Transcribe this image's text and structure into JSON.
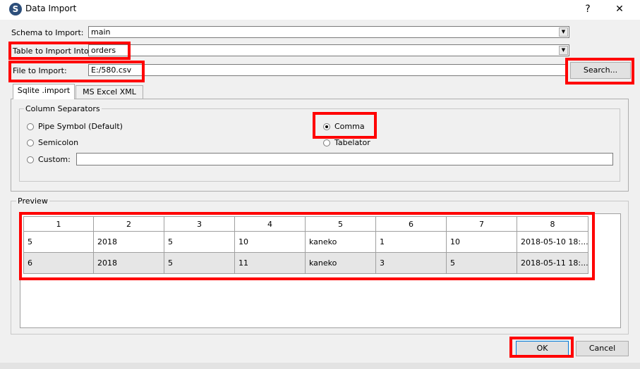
{
  "window": {
    "title": "Data Import",
    "help_glyph": "?",
    "close_glyph": "✕",
    "icon_letter": "S"
  },
  "form": {
    "schema_label": "Schema to Import:",
    "schema_value": "main",
    "table_label": "Table to Import Into:",
    "table_value": "orders",
    "file_label": "File to Import:",
    "file_value": "E:/580.csv",
    "search_label": "Search..."
  },
  "tabs": [
    {
      "label": "Sqlite .import"
    },
    {
      "label": "MS Excel XML"
    }
  ],
  "separators": {
    "group_label": "Column Separators",
    "pipe": "Pipe Symbol (Default)",
    "semicolon": "Semicolon",
    "custom": "Custom:",
    "comma": "Comma",
    "tabulator": "Tabelator",
    "selected": "comma"
  },
  "preview": {
    "group_label": "Preview",
    "columns": [
      "1",
      "2",
      "3",
      "4",
      "5",
      "6",
      "7",
      "8"
    ],
    "rows": [
      [
        "5",
        "2018",
        "5",
        "10",
        "kaneko",
        "1",
        "10",
        "2018-05-10 18:..."
      ],
      [
        "6",
        "2018",
        "5",
        "11",
        "kaneko",
        "3",
        "5",
        "2018-05-11 18:..."
      ]
    ]
  },
  "buttons": {
    "ok": "OK",
    "cancel": "Cancel"
  }
}
